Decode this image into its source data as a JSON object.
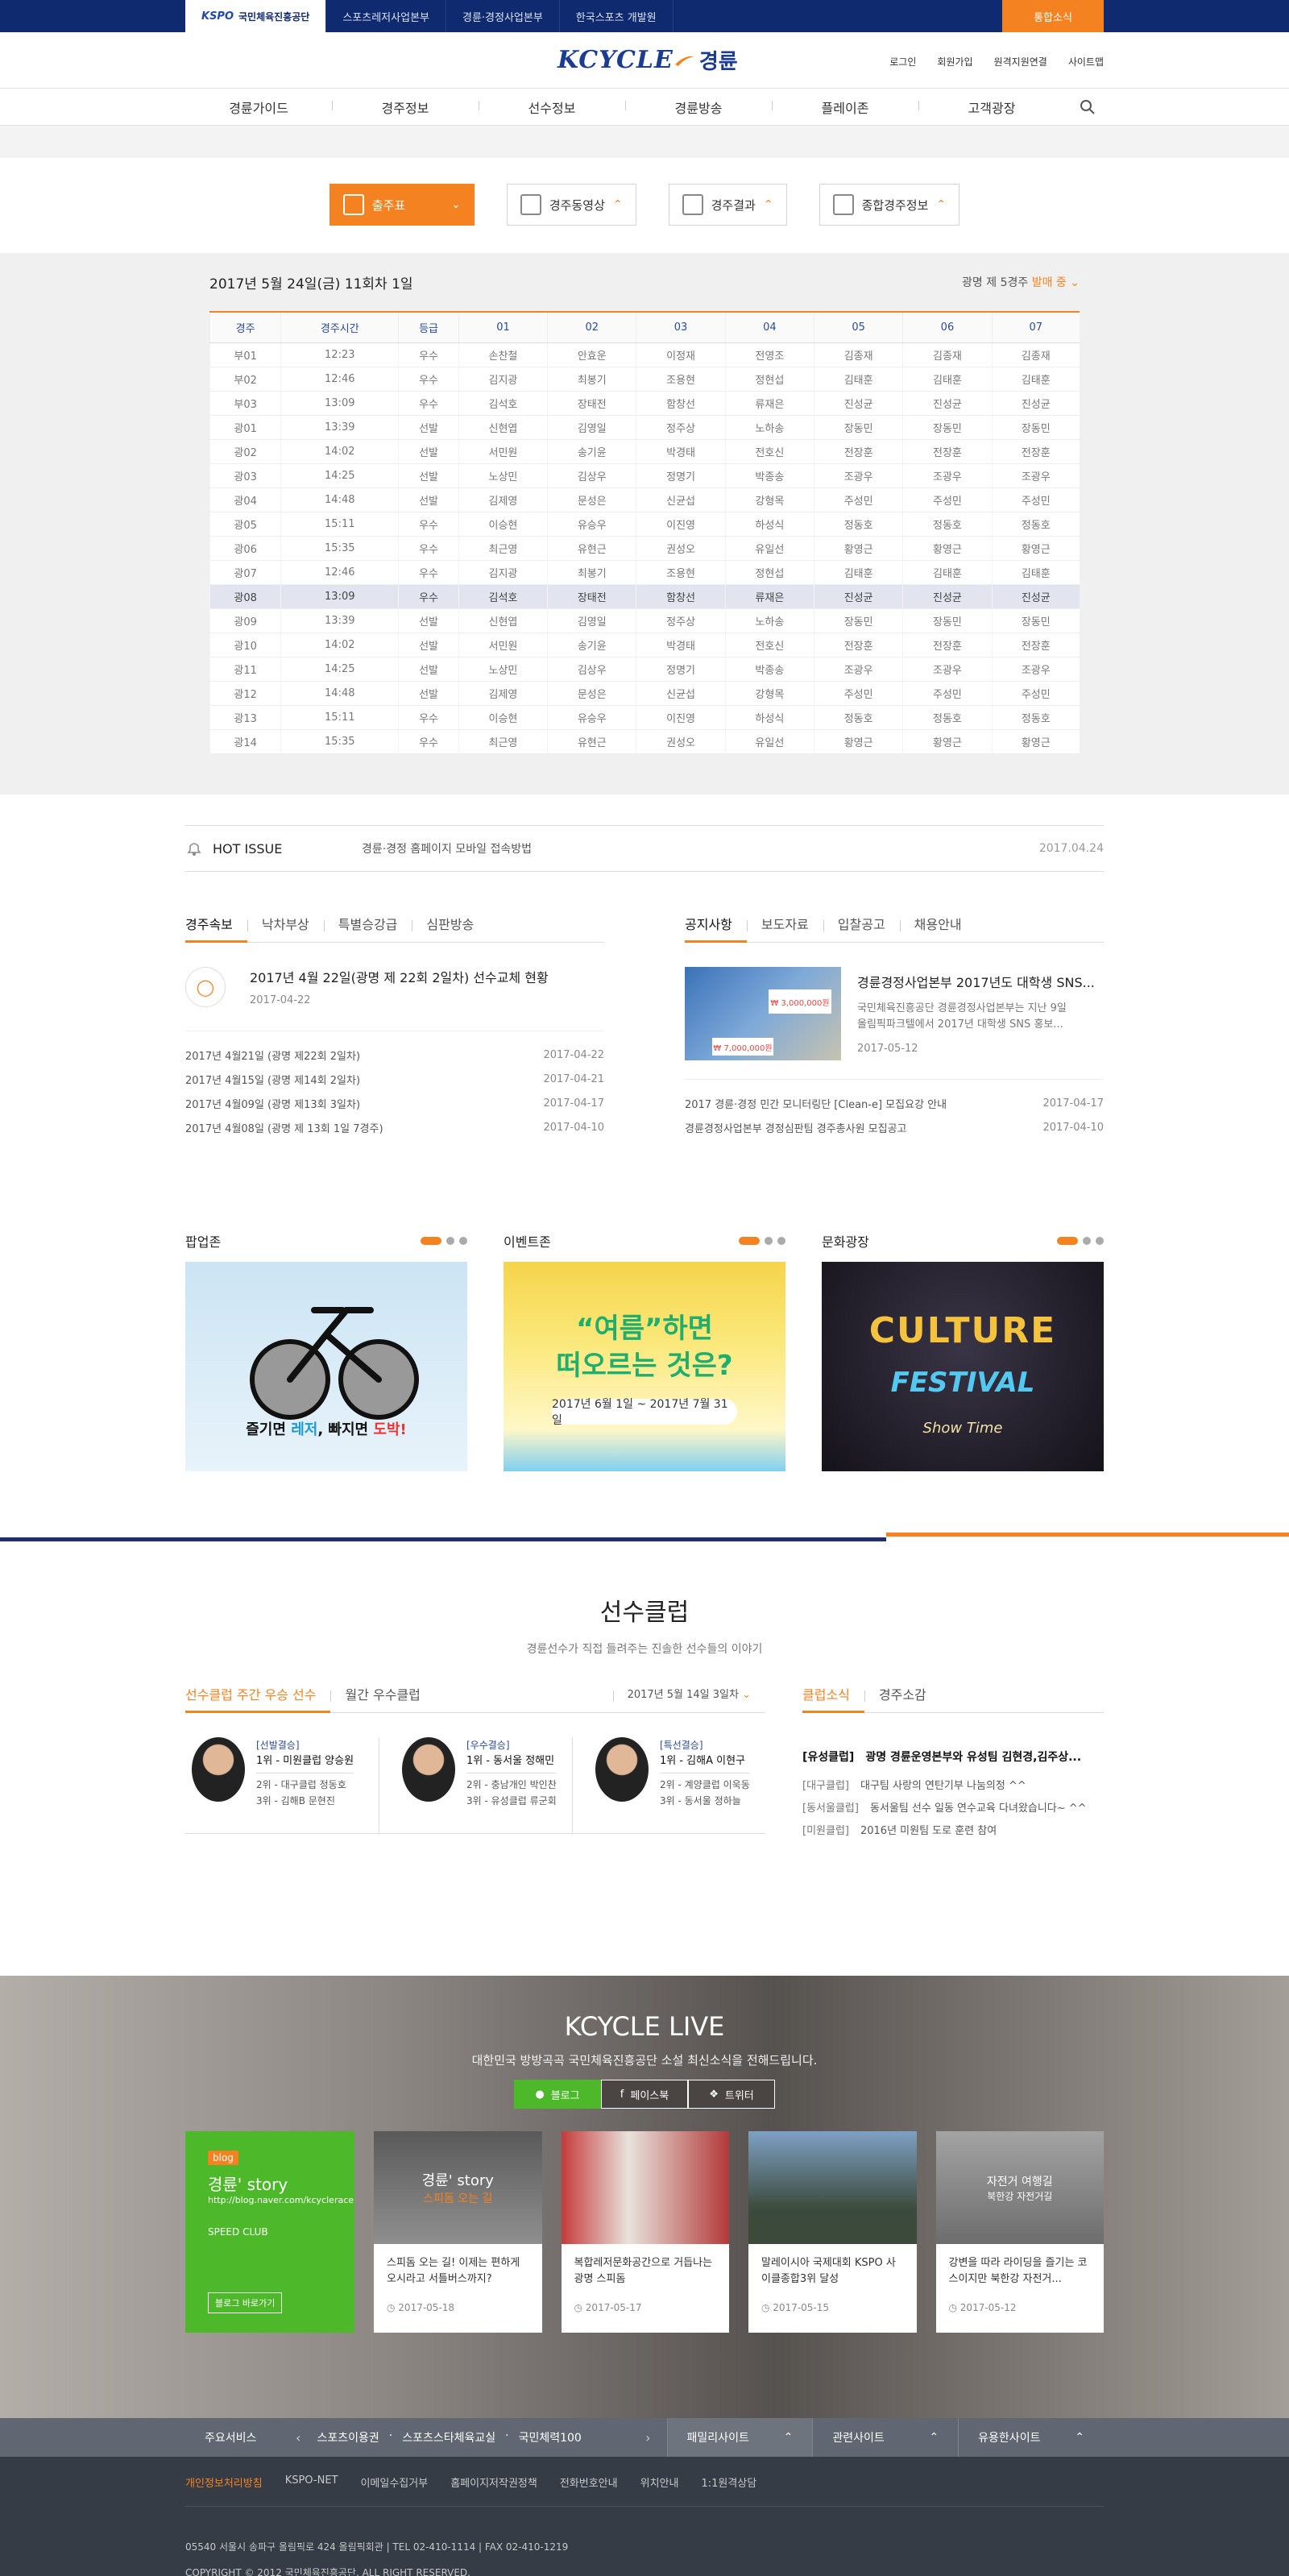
{
  "topbar": {
    "tabs": [
      {
        "logo": "KSPO",
        "label": "국민체육진흥공단"
      },
      {
        "label": "스포츠레저사업본부"
      },
      {
        "label": "경륜·경정사업본부"
      },
      {
        "label": "한국스포츠 개발원"
      }
    ],
    "integrated": "통합소식"
  },
  "header": {
    "logo_main": "KCYCLE",
    "logo_sub": "경륜",
    "utils": [
      "로그인",
      "회원가입",
      "원격지원연결",
      "사이트맵"
    ]
  },
  "gnb": [
    "경륜가이드",
    "경주정보",
    "선수정보",
    "경륜방송",
    "플레이존",
    "고객광장"
  ],
  "race_buttons": [
    "출주표",
    "경주동영상",
    "경주결과",
    "종합경주정보"
  ],
  "race": {
    "date": "2017년 5월 24일(금) 11회차 1일",
    "status_prefix": "광명 제 5경주",
    "status_suffix": "발매 중",
    "columns": [
      "경주",
      "경주시간",
      "등급",
      "01",
      "02",
      "03",
      "04",
      "05",
      "06",
      "07"
    ],
    "highlight": 10,
    "rows": [
      [
        "부01",
        "12:23",
        "우수",
        "손찬철",
        "안효운",
        "이정재",
        "전영조",
        "김종재",
        "김종재",
        "김종재"
      ],
      [
        "부02",
        "12:46",
        "우수",
        "김지광",
        "최봉기",
        "조용현",
        "정현섭",
        "김태훈",
        "김태훈",
        "김태훈"
      ],
      [
        "부03",
        "13:09",
        "우수",
        "김석호",
        "장태전",
        "함창선",
        "류재은",
        "진성균",
        "진성균",
        "진성균"
      ],
      [
        "광01",
        "13:39",
        "선발",
        "신현엽",
        "김영일",
        "정주상",
        "노하송",
        "장동민",
        "장동민",
        "장동민"
      ],
      [
        "광02",
        "14:02",
        "선발",
        "서민원",
        "송기윤",
        "박경태",
        "전호신",
        "전장훈",
        "전장훈",
        "전장훈"
      ],
      [
        "광03",
        "14:25",
        "선발",
        "노상민",
        "김상우",
        "정명기",
        "박종송",
        "조광우",
        "조광우",
        "조광우"
      ],
      [
        "광04",
        "14:48",
        "선발",
        "김제영",
        "문성은",
        "신균섭",
        "강형목",
        "주성민",
        "주성민",
        "주성민"
      ],
      [
        "광05",
        "15:11",
        "우수",
        "이승현",
        "유승우",
        "이진영",
        "하성식",
        "정동호",
        "정동호",
        "정동호"
      ],
      [
        "광06",
        "15:35",
        "우수",
        "최근영",
        "유현근",
        "권성오",
        "유일선",
        "황영근",
        "황영근",
        "황영근"
      ],
      [
        "광07",
        "12:46",
        "우수",
        "김지광",
        "최봉기",
        "조용현",
        "정현섭",
        "김태훈",
        "김태훈",
        "김태훈"
      ],
      [
        "광08",
        "13:09",
        "우수",
        "김석호",
        "장태전",
        "함창선",
        "류재은",
        "진성균",
        "진성균",
        "진성균"
      ],
      [
        "광09",
        "13:39",
        "선발",
        "신현엽",
        "김영일",
        "정주상",
        "노하송",
        "장동민",
        "장동민",
        "장동민"
      ],
      [
        "광10",
        "14:02",
        "선발",
        "서민원",
        "송기윤",
        "박경태",
        "전호신",
        "전장훈",
        "전장훈",
        "전장훈"
      ],
      [
        "광11",
        "14:25",
        "선발",
        "노상민",
        "김상우",
        "정명기",
        "박종송",
        "조광우",
        "조광우",
        "조광우"
      ],
      [
        "광12",
        "14:48",
        "선발",
        "김제영",
        "문성은",
        "신균섭",
        "강형목",
        "주성민",
        "주성민",
        "주성민"
      ],
      [
        "광13",
        "15:11",
        "우수",
        "이승현",
        "유승우",
        "이진영",
        "하성식",
        "정동호",
        "정동호",
        "정동호"
      ],
      [
        "광14",
        "15:35",
        "우수",
        "최근영",
        "유현근",
        "권성오",
        "유일선",
        "황영근",
        "황영근",
        "황영근"
      ]
    ]
  },
  "hot": {
    "label": "HOT ISSUE",
    "text": "경륜·경정 홈페이지 모바일 접속방법",
    "date": "2017.04.24"
  },
  "news_left": {
    "tabs": [
      "경주속보",
      "낙차부상",
      "특별승강급",
      "심판방송"
    ],
    "feature": {
      "title": "2017년 4월 22일(광명 제 22회 2일차) 선수교체 현황",
      "date": "2017-04-22"
    },
    "list": [
      {
        "t": "2017년 4월21일 (광명 제22회 2일차)",
        "d": "2017-04-22"
      },
      {
        "t": "2017년 4월15일 (광명 제14회 2일차)",
        "d": "2017-04-21"
      },
      {
        "t": "2017년 4월09일 (광명 제13회 3일차)",
        "d": "2017-04-17"
      },
      {
        "t": "2017년 4월08일 (광명 제 13회 1일 7경주)",
        "d": "2017-04-10"
      }
    ]
  },
  "news_right": {
    "tabs": [
      "공지사항",
      "보도자료",
      "입찰공고",
      "채용안내"
    ],
    "feature": {
      "title": "경륜경정사업본부 2017년도 대학생 SNS...",
      "body1": "국민체육진흥공단 경륜경정사업본부는 지난 9일",
      "body2": "올림픽파크텔에서 2017년 대학생 SNS 홍보...",
      "date": "2017-05-12",
      "img_amt1": "₩ 3,000,000원",
      "img_amt2": "₩ 7,000,000원"
    },
    "list": [
      {
        "t": "2017 경륜·경정 민간 모니터링단 [Clean-e] 모집요강 안내",
        "d": "2017-04-17"
      },
      {
        "t": "경륜경정사업본부 경정심판팀 경주총사원 모집공고",
        "d": "2017-04-10"
      }
    ]
  },
  "zones": {
    "popup": {
      "title": "팝업존",
      "cap_a": "즐기면 ",
      "cap_b": "레저",
      "cap_c": ", 빠지면 ",
      "cap_d": "도박!"
    },
    "event": {
      "title": "이벤트존",
      "big1": "“여름”하면",
      "big2": "떠오르는 것은?",
      "date": "2017년 6월 1일 ~ 2017년 7월 31일"
    },
    "culture": {
      "title": "문화광장",
      "t1": "CULTURE",
      "t2": "FESTIVAL",
      "t3": "Show Time"
    }
  },
  "club": {
    "title": "선수클럽",
    "sub": "경륜선수가 직접 들려주는 진솔한 선수들의 이야기",
    "tabs": [
      "선수클럽 주간 우승 선수",
      "월간 우수클럽"
    ],
    "date": "2017년 5월 14일  3일차",
    "players": [
      {
        "grade": "[선발결승]",
        "first": "1위 - 미원클럽 양승원",
        "second": "2위 - 대구클럽 정동호",
        "third": "3위 - 김해B 문현진"
      },
      {
        "grade": "[우수결승]",
        "first": "1위 - 동서울 정해민",
        "second": "2위 - 충남개인 박인찬",
        "third": "3위 - 유성클럽 류군회"
      },
      {
        "grade": "[특선결승]",
        "first": "1위 - 김해A 이현구",
        "second": "2위 - 계양클럽 이욱동",
        "third": "3위 - 동서울 정하늘"
      }
    ],
    "rtabs": [
      "클럽소식",
      "경주소감"
    ],
    "rnews": [
      {
        "c": "[유성클럽]",
        "t": "광명 경륜운영본부와 유성팀 김현경,김주상..."
      },
      {
        "c": "[대구클럽]",
        "t": "대구팀 사랑의 연탄기부 나눔의정 ^^"
      },
      {
        "c": "[동서울클럽]",
        "t": "동서울팀 선수 일동 연수교육 다녀왔습니다~ ^^"
      },
      {
        "c": "[미원클럽]",
        "t": "2016년 미원팀 도로 훈련 참여"
      }
    ]
  },
  "live": {
    "title": "KCYCLE LIVE",
    "sub": "대한민국 방방곡곡 국민체육진흥공단 소설 최신소식을 전해드립니다.",
    "sns": [
      "블로그",
      "페이스북",
      "트위터"
    ],
    "blog": {
      "tag": "blog",
      "name": "경륜' story",
      "url": "http://blog.naver.com/kcyclerace",
      "club": "SPEED CLUB",
      "go": "블로그 바로가기"
    },
    "cards": [
      {
        "img": "경륜' story",
        "img2": "스피돔 오는 길",
        "t": "스피돔 오는 길! 이제는 편하게 오시라고 서틀버스까지?",
        "d": "2017-05-18"
      },
      {
        "img": "",
        "img2": "",
        "t": "복합레저문화공간으로 거듭나는 광명 스피돔",
        "d": "2017-05-17"
      },
      {
        "img": "",
        "img2": "",
        "t": "말레이시아 국제대회 KSPO 사이클종합3위 달성",
        "d": "2017-05-15"
      },
      {
        "img": "자전거 여행길",
        "img2": "북한강 자전거길",
        "t": "강변을 따라 라이딩을 즐기는 코스이지만 북한강 자전거...",
        "d": "2017-05-12"
      }
    ]
  },
  "footer": {
    "svc_label": "주요서비스",
    "svc_links": [
      "스포츠이용권",
      "스포츠스타체육교실",
      "국민체력100"
    ],
    "dd": [
      "패밀리사이트",
      "관련사이트",
      "유용한사이트"
    ],
    "links": [
      "개인정보처리방침",
      "KSPO-NET",
      "이메일수집거부",
      "홈페이지저작권정책",
      "전화번호안내",
      "위치안내",
      "1:1원격상담"
    ],
    "addr": "05540 서울시 송파구 올림픽로 424 올림픽회관  |  TEL 02-410-1114  |  FAX 02-410-1219",
    "copy": "COPYRIGHT © 2012 국민체육진흥공단. ALL RIGHT RESERVED."
  },
  "colors": {
    "orange": "#f58220",
    "navy": "#0f2a6e",
    "green": "#4db82a"
  }
}
